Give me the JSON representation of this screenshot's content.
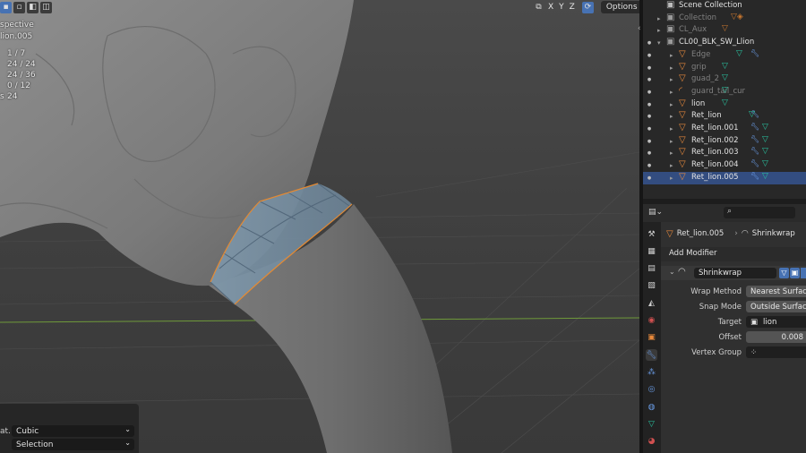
{
  "viewport": {
    "overlay_lines": [
      "spective",
      "lion.005"
    ],
    "stats": [
      {
        "label": "",
        "value": "1 / 7"
      },
      {
        "label": "",
        "value": "24 / 24"
      },
      {
        "label": "",
        "value": "24 / 36"
      },
      {
        "label": "",
        "value": "0 / 12"
      },
      {
        "label": "s",
        "value": "24"
      }
    ],
    "axes": [
      "X",
      "Y",
      "Z"
    ],
    "options_label": "Options",
    "operator_panel": {
      "interpolation_label": "at.",
      "interpolation_value": "Cubic",
      "mode_value": "Selection"
    }
  },
  "outliner": {
    "rows": [
      {
        "label": "Scene Collection",
        "type": "scene",
        "indent": 0,
        "dim": false,
        "selected": false,
        "visible": false,
        "expand": ""
      },
      {
        "label": "Collection",
        "type": "collection",
        "indent": 1,
        "dim": true,
        "selected": false,
        "visible": false,
        "expand": "▸"
      },
      {
        "label": "CL_Aux",
        "type": "collection",
        "indent": 1,
        "dim": true,
        "selected": false,
        "visible": false,
        "expand": "▸"
      },
      {
        "label": "CL00_BLK_SW_Llion",
        "type": "collection",
        "indent": 1,
        "dim": false,
        "selected": false,
        "visible": true,
        "expand": "▾"
      },
      {
        "label": "Edge",
        "type": "mesh",
        "indent": 2,
        "dim": true,
        "selected": false,
        "visible": true,
        "expand": "▸"
      },
      {
        "label": "grip",
        "type": "mesh",
        "indent": 2,
        "dim": true,
        "selected": false,
        "visible": true,
        "expand": "▸"
      },
      {
        "label": "guad_2",
        "type": "mesh",
        "indent": 2,
        "dim": true,
        "selected": false,
        "visible": true,
        "expand": "▸"
      },
      {
        "label": "guard_tail_cur",
        "type": "curve",
        "indent": 2,
        "dim": true,
        "selected": false,
        "visible": true,
        "expand": "▸"
      },
      {
        "label": "lion",
        "type": "mesh",
        "indent": 2,
        "dim": false,
        "selected": false,
        "visible": true,
        "expand": "▸"
      },
      {
        "label": "Ret_lion",
        "type": "mesh",
        "indent": 2,
        "dim": false,
        "selected": false,
        "visible": true,
        "expand": "▸"
      },
      {
        "label": "Ret_lion.001",
        "type": "mesh",
        "indent": 2,
        "dim": false,
        "selected": false,
        "visible": true,
        "expand": "▸"
      },
      {
        "label": "Ret_lion.002",
        "type": "mesh",
        "indent": 2,
        "dim": false,
        "selected": false,
        "visible": true,
        "expand": "▸"
      },
      {
        "label": "Ret_lion.003",
        "type": "mesh",
        "indent": 2,
        "dim": false,
        "selected": false,
        "visible": true,
        "expand": "▸"
      },
      {
        "label": "Ret_lion.004",
        "type": "mesh",
        "indent": 2,
        "dim": false,
        "selected": false,
        "visible": true,
        "expand": "▸"
      },
      {
        "label": "Ret_lion.005",
        "type": "mesh",
        "indent": 2,
        "dim": false,
        "selected": true,
        "visible": true,
        "expand": "▸"
      }
    ]
  },
  "properties": {
    "search_placeholder": "",
    "breadcrumb_object": "Ret_lion.005",
    "breadcrumb_separator": "›",
    "breadcrumb_modifier": "Shrinkwrap",
    "add_modifier_label": "Add Modifier",
    "modifier": {
      "name": "Shrinkwrap",
      "fields": [
        {
          "label": "Wrap Method",
          "value": "Nearest Surface",
          "kind": "select"
        },
        {
          "label": "Snap Mode",
          "value": "Outside Surface",
          "kind": "select"
        },
        {
          "label": "Target",
          "value": "lion",
          "kind": "object"
        },
        {
          "label": "Offset",
          "value": "0.008",
          "kind": "number"
        },
        {
          "label": "Vertex Group",
          "value": "",
          "kind": "group"
        }
      ]
    },
    "tabs": [
      "tool",
      "render",
      "output",
      "view-layer",
      "scene",
      "world",
      "object",
      "modifiers",
      "particles",
      "physics",
      "constraints",
      "data",
      "material"
    ]
  },
  "colors": {
    "accent_selected": "#334d80",
    "object_orange": "#e8893b",
    "mesh_data_green": "#29c3a0",
    "modifier_blue": "#6a9ce6",
    "active_blue": "#4772b3"
  }
}
